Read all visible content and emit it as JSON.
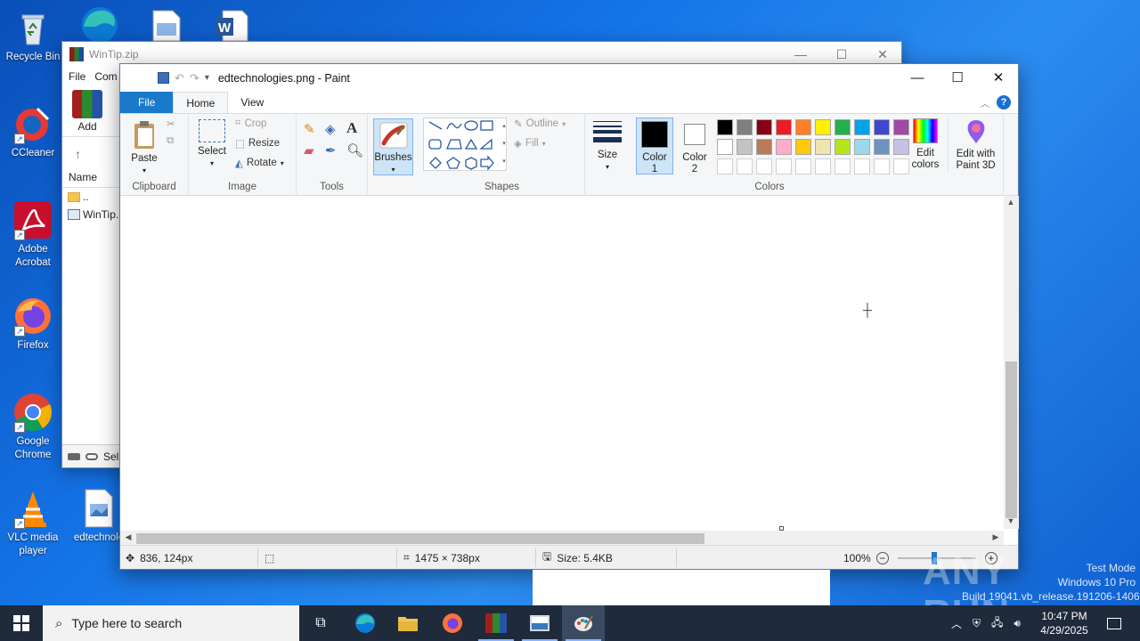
{
  "desktop": {
    "icons": [
      {
        "label": "Recycle Bin"
      },
      {
        "label": "CCleaner"
      },
      {
        "label": "Adobe Acrobat"
      },
      {
        "label": "Firefox"
      },
      {
        "label": "Google Chrome"
      },
      {
        "label": "VLC media player"
      },
      {
        "label": "edtechnolo"
      }
    ]
  },
  "winrar": {
    "title": "WinTip.zip",
    "menu": [
      "File",
      "Com"
    ],
    "add_label": "Add",
    "column_name": "Name",
    "rows": [
      "..",
      "WinTip."
    ],
    "status_text": "Sele"
  },
  "paint": {
    "title": "edtechnologies.png - Paint",
    "tabs": {
      "file": "File",
      "home": "Home",
      "view": "View"
    },
    "clipboard": {
      "paste": "Paste",
      "group": "Clipboard"
    },
    "image": {
      "select": "Select",
      "crop": "Crop",
      "resize": "Resize",
      "rotate": "Rotate",
      "group": "Image"
    },
    "tools": {
      "group": "Tools"
    },
    "brushes": {
      "label": "Brushes"
    },
    "shapes": {
      "outline": "Outline",
      "fill": "Fill",
      "group": "Shapes"
    },
    "size": {
      "label": "Size"
    },
    "colors": {
      "color1": "Color 1",
      "color2": "Color 2",
      "edit_colors": "Edit colors",
      "edit_paint3d": "Edit with Paint 3D",
      "group": "Colors",
      "color1_value": "#000000",
      "color2_value": "#ffffff",
      "row1": [
        "#000000",
        "#7f7f7f",
        "#880015",
        "#ed1c24",
        "#ff7f27",
        "#fff200",
        "#22b14c",
        "#00a2e8",
        "#3f48cc",
        "#a349a4"
      ],
      "row2": [
        "#ffffff",
        "#c3c3c3",
        "#b97a57",
        "#ffaec9",
        "#ffc90e",
        "#efe4b0",
        "#b5e61d",
        "#99d9ea",
        "#7092be",
        "#c8bfe7"
      ]
    },
    "status": {
      "cursor_pos": "836, 124px",
      "image_size": "1475 × 738px",
      "file_size": "Size: 5.4KB",
      "zoom": "100%"
    }
  },
  "taskbar": {
    "search_placeholder": "Type here to search",
    "time": "10:47 PM",
    "date": "4/29/2025"
  },
  "watermark": {
    "line1": "Test Mode",
    "line2": "Windows 10 Pro",
    "line3": "Build 19041.vb_release.191206-1406",
    "brand": "ANY RUN"
  }
}
